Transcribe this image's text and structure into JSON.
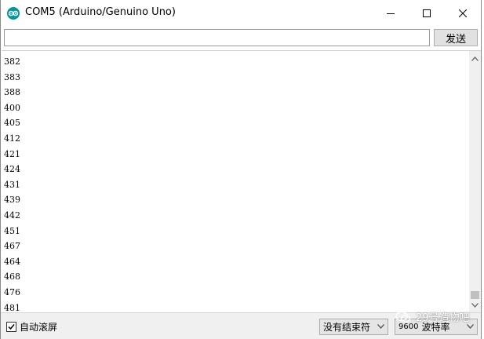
{
  "window": {
    "title": "COM5 (Arduino/Genuino Uno)"
  },
  "send_row": {
    "input_value": "",
    "send_label": "发送"
  },
  "output": {
    "lines": [
      "382",
      "383",
      "388",
      "400",
      "405",
      "412",
      "421",
      "424",
      "431",
      "439",
      "442",
      "451",
      "467",
      "464",
      "468",
      "476",
      "481"
    ]
  },
  "status_bar": {
    "autoscroll_label": "自动滚屏",
    "autoscroll_checked": true,
    "line_ending": "没有结束符",
    "baud_value": "9600",
    "baud_label": "波特率"
  },
  "watermark": {
    "text": "29号造物吧"
  },
  "colors": {
    "arduino_teal": "#00979c",
    "scrollbar_track": "#f0f0f0",
    "button_face": "#e1e1e1"
  }
}
